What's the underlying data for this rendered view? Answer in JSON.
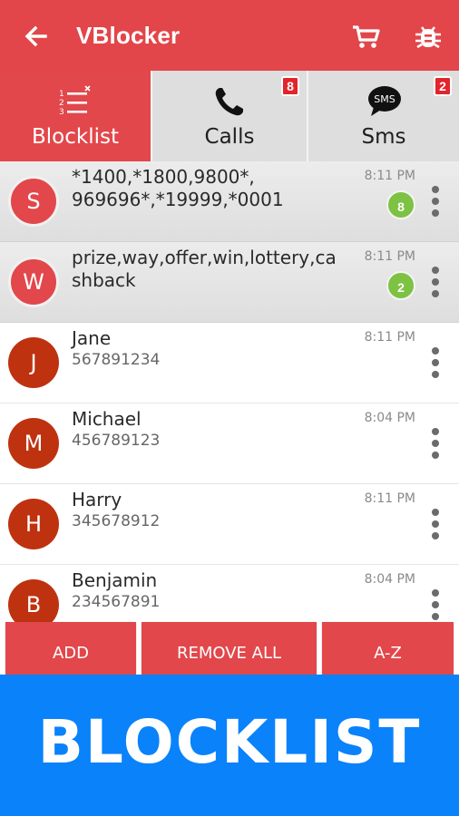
{
  "app": {
    "title": "VBlocker",
    "accent_color": "#e2464a",
    "icons": {
      "back": "arrow-left-icon",
      "cart": "cart-icon",
      "bug": "bug-icon"
    }
  },
  "tabs": [
    {
      "label": "Blocklist",
      "icon": "list-numbered-icon",
      "active": true,
      "badge": ""
    },
    {
      "label": "Calls",
      "icon": "phone-icon",
      "active": false,
      "badge": "8"
    },
    {
      "label": "Sms",
      "icon": "sms-bubble-icon",
      "active": false,
      "badge": "2",
      "icon_text": "SMS"
    }
  ],
  "list": [
    {
      "initial": "S",
      "name": "*1400,*1800,9800*, 969696*,*19999,*0001",
      "sub": "",
      "time": "8:11 PM",
      "count": "8"
    },
    {
      "initial": "W",
      "name": "prize,way,offer,win,lottery,ca shback",
      "sub": "",
      "time": "8:11 PM",
      "count": "2"
    },
    {
      "initial": "J",
      "name": "Jane",
      "sub": "567891234",
      "time": "8:11 PM",
      "count": ""
    },
    {
      "initial": "M",
      "name": "Michael",
      "sub": "456789123",
      "time": "8:04 PM",
      "count": ""
    },
    {
      "initial": "H",
      "name": "Harry",
      "sub": "345678912",
      "time": "8:11 PM",
      "count": ""
    },
    {
      "initial": "B",
      "name": "Benjamin",
      "sub": "234567891",
      "time": "8:04 PM",
      "count": ""
    }
  ],
  "actions": {
    "add": "ADD",
    "remove_all": "REMOVE ALL",
    "az": "A-Z"
  },
  "banner": {
    "text": "BLOCKLIST",
    "color": "#0a82fa"
  }
}
